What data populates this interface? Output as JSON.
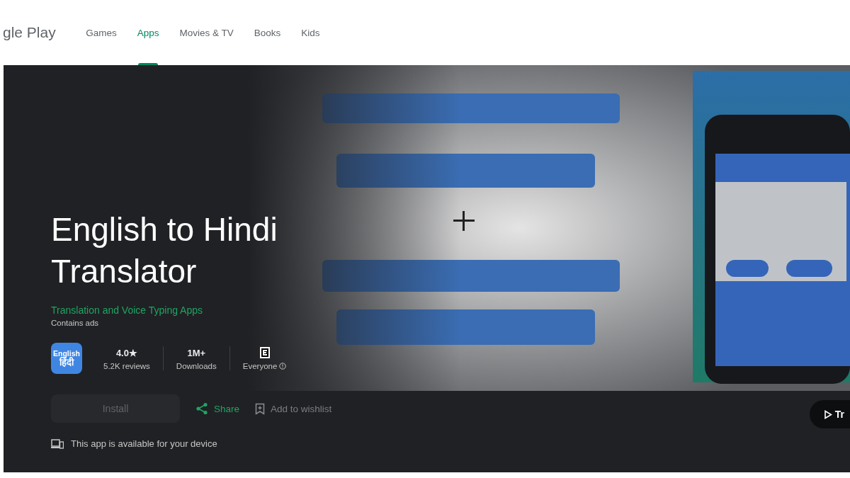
{
  "header": {
    "logo_text": "gle Play",
    "nav": [
      {
        "label": "Games",
        "selected": false
      },
      {
        "label": "Apps",
        "selected": true
      },
      {
        "label": "Movies & TV",
        "selected": false
      },
      {
        "label": "Books",
        "selected": false
      },
      {
        "label": "Kids",
        "selected": false
      }
    ]
  },
  "hero": {
    "title": "English to Hindi Translator",
    "developer": "Translation and Voice Typing Apps",
    "ads_note": "Contains ads",
    "app_icon": {
      "top": "English",
      "bottom": "हिंदी"
    },
    "stats": [
      {
        "kind": "rating",
        "value": "4.0★",
        "caption": "5.2K reviews"
      },
      {
        "kind": "plain",
        "value": "1M+",
        "caption": "Downloads"
      },
      {
        "kind": "content-rating",
        "caption": "Everyone"
      }
    ],
    "install": {
      "label": "Install",
      "disabled": true
    },
    "share": {
      "label": "Share"
    },
    "wishlist": {
      "label": "Add to wishlist",
      "disabled": true
    },
    "trailer": {
      "label": "Tr"
    },
    "device_note": "This app is available for your device"
  }
}
